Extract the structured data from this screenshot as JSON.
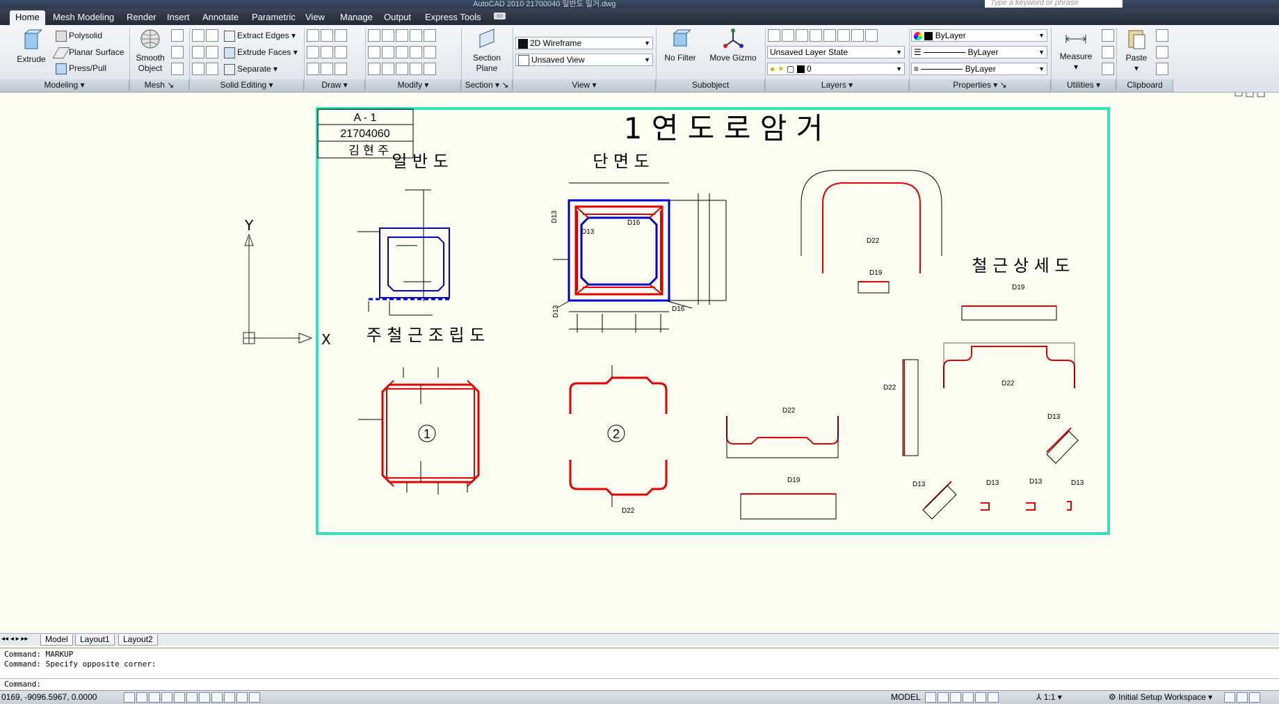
{
  "app": {
    "title": "AutoCAD 2010    21700040 일반도 일거.dwg",
    "search_placeholder": "Type a keyword or phrase"
  },
  "tabs": [
    "Home",
    "Mesh Modeling",
    "Render",
    "Insert",
    "Annotate",
    "Parametric",
    "View",
    "Manage",
    "Output",
    "Express Tools"
  ],
  "ribbon": {
    "modeling": {
      "extrude": "Extrude",
      "polysolid": "Polysolid",
      "planar_surface": "Planar Surface",
      "press_pull": "Press/Pull",
      "panel": "Modeling"
    },
    "mesh": {
      "smooth_object_1": "Smooth",
      "smooth_object_2": "Object",
      "panel": "Mesh"
    },
    "solid_editing": {
      "extract_edges": "Extract Edges",
      "extrude_faces": "Extrude Faces",
      "separate": "Separate",
      "panel": "Solid Editing"
    },
    "draw": {
      "panel": "Draw"
    },
    "modify": {
      "panel": "Modify"
    },
    "section": {
      "section_plane_1": "Section",
      "section_plane_2": "Plane",
      "panel": "Section"
    },
    "view": {
      "visual_style": "2D Wireframe",
      "named_view": "Unsaved View",
      "panel": "View"
    },
    "subobject": {
      "no_filter": "No Filter",
      "move_gizmo": "Move Gizmo",
      "panel": "Subobject"
    },
    "layers": {
      "layer_state": "Unsaved Layer State",
      "current_layer": "0",
      "panel": "Layers"
    },
    "properties": {
      "color": "ByLayer",
      "linetype": "ByLayer",
      "lineweight": "ByLayer",
      "panel": "Properties"
    },
    "utilities": {
      "measure": "Measure",
      "panel": "Utilities"
    },
    "clipboard": {
      "paste": "Paste",
      "panel": "Clipboard"
    }
  },
  "drawing": {
    "titleblock": {
      "sheet": "A - 1",
      "student_id": "21704060",
      "name": "김 현 주"
    },
    "title": "1 연 도 로 암 거",
    "labels": {
      "general": "일 반 도",
      "section": "단 면 도",
      "assembly": "주 철 근 조 립 도",
      "rebar_detail": "철 근 상 세 도"
    },
    "marks": {
      "one": "1",
      "two": "2"
    },
    "rebar": {
      "d13": "D13",
      "d16": "D16",
      "d19": "D19",
      "d22": "D22"
    },
    "ucs": {
      "x": "X",
      "y": "Y"
    }
  },
  "layout_tabs": [
    "Model",
    "Layout1",
    "Layout2"
  ],
  "command": {
    "history": [
      "Command: MARKUP",
      "Command: Specify opposite corner:"
    ],
    "prompt": "Command:"
  },
  "status": {
    "coords": "0169,  -9096.5967, 0.0000",
    "model": "MODEL",
    "scale": "1:1",
    "workspace": "Initial Setup Workspace"
  },
  "colors": {
    "frame": "#2ee6b8",
    "rebar": "#e00000",
    "concrete": "#0000cc",
    "tabbar": "#2b3345"
  }
}
